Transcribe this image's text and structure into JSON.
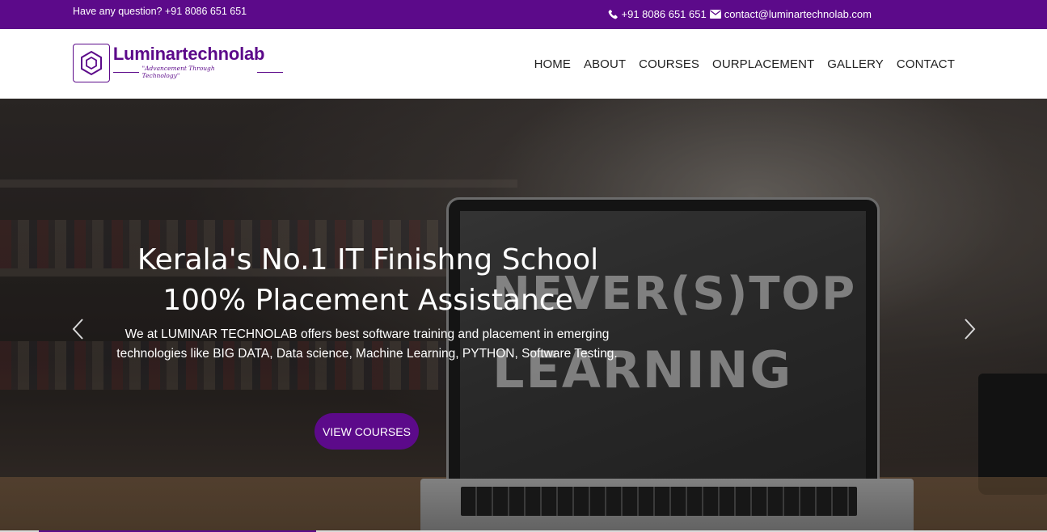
{
  "topbar": {
    "question": "Have any question? +91 8086 651 651",
    "phone": "+91 8086 651 651",
    "email": "contact@luminartechnolab.com",
    "phone_icon": "phone-icon",
    "email_icon": "envelope-icon"
  },
  "brand": {
    "name": "Luminartechnolab",
    "tagline": "\"Advancement Through Technology\"",
    "logo_icon": "hexagon-logo-icon"
  },
  "nav": {
    "items": [
      "HOME",
      "ABOUT",
      "COURSES",
      "OURPLACEMENT",
      "GALLERY",
      "CONTACT"
    ]
  },
  "hero": {
    "title_line1": "Kerala's No.1 IT Finishng School",
    "title_line2": "100% Placement Assistance",
    "description": "We at LUMINAR TECHNOLAB offers best software training and placement in emerging technologies like BIG DATA, Data science, Machine Learning, PYTHON, Software Testing.",
    "cta_label": "VIEW COURSES",
    "prev_icon": "chevron-left-icon",
    "next_icon": "chevron-right-icon"
  },
  "colors": {
    "brand": "#5c0a8a",
    "topbar_bg": "#5c0a8a",
    "nav_text": "#222222"
  }
}
